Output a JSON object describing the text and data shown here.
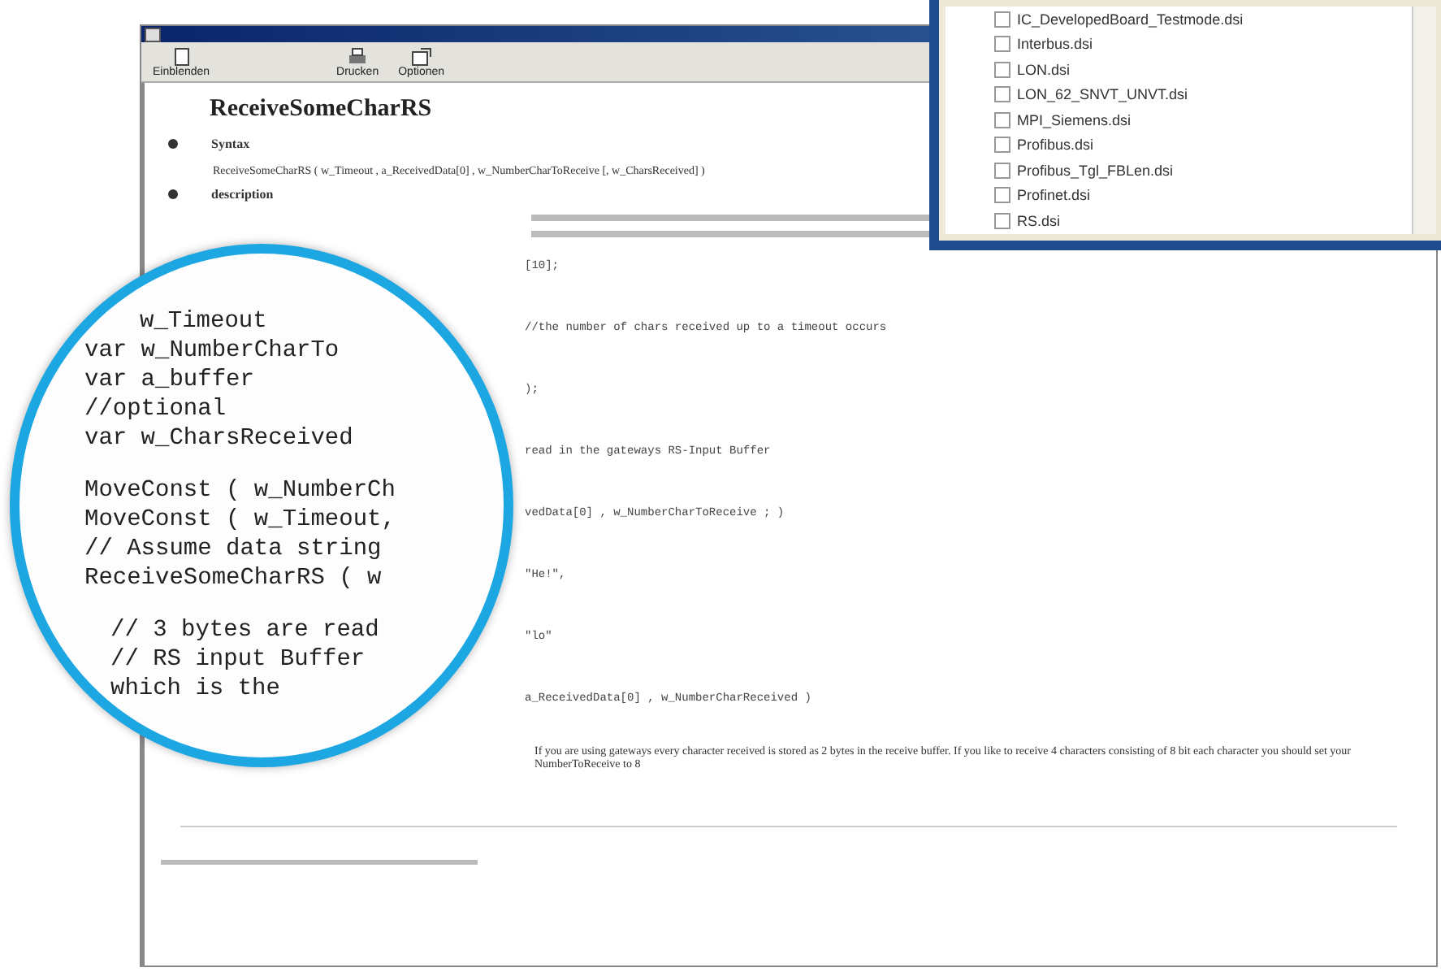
{
  "help_window": {
    "toolbar": [
      {
        "label": "Einblenden"
      },
      {
        "label": "Drucken"
      },
      {
        "label": "Optionen"
      }
    ],
    "heading": "ReceiveSomeCharRS",
    "sections": [
      {
        "title": "Syntax"
      },
      {
        "title": "description"
      }
    ],
    "syntax": "ReceiveSomeCharRS ( w_Timeout , a_ReceivedData[0] , w_NumberCharToReceive [, w_CharsReceived] )",
    "code_lines": [
      "[10];",
      "//the number of chars received up to a timeout occurs",
      ");",
      "read in the gateways RS-Input Buffer",
      "vedData[0] , w_NumberCharToReceive ; )",
      "\"He!\",",
      "\"lo\"",
      "a_ReceivedData[0] , w_NumberCharReceived )"
    ],
    "note": "If you are using gateways every character received is stored as 2 bytes in the receive buffer. If you like to receive 4 characters consisting of 8 bit each character you should set your NumberToReceive to 8"
  },
  "magnifier": {
    "blocks": [
      [
        "w_Timeout",
        "var w_NumberCharTo",
        "var a_buffer",
        "//optional",
        "var w_CharsReceived"
      ],
      [
        "MoveConst ( w_NumberCh",
        "MoveConst ( w_Timeout,",
        "// Assume data string",
        "ReceiveSomeCharRS ( w"
      ],
      [
        "// 3 bytes are read",
        "// RS input Buffer",
        "which is the"
      ]
    ]
  },
  "file_list": {
    "items": [
      {
        "name": "IC_DevelopedBoard_Testmode.dsi",
        "checked": false
      },
      {
        "name": "Interbus.dsi",
        "checked": false
      },
      {
        "name": "LON.dsi",
        "checked": false
      },
      {
        "name": "LON_62_SNVT_UNVT.dsi",
        "checked": false
      },
      {
        "name": "MPI_Siemens.dsi",
        "checked": false
      },
      {
        "name": "Profibus.dsi",
        "checked": false
      },
      {
        "name": "Profibus_Tgl_FBLen.dsi",
        "checked": false
      },
      {
        "name": "Profinet.dsi",
        "checked": false
      },
      {
        "name": "RS.dsi",
        "checked": false
      }
    ]
  }
}
